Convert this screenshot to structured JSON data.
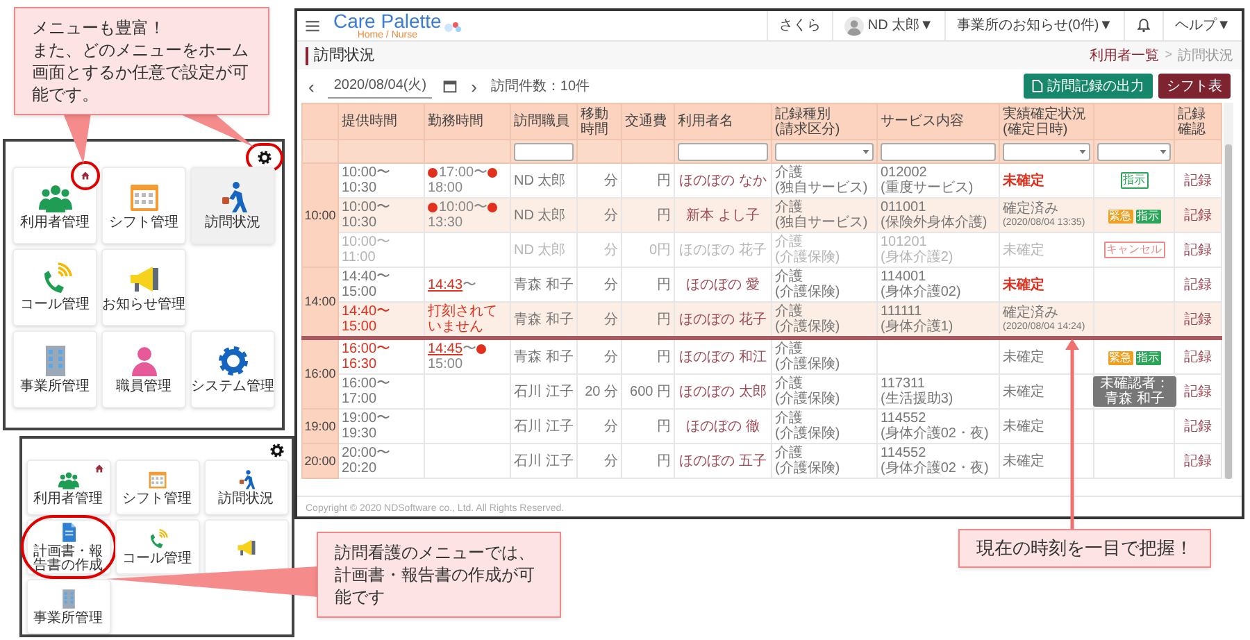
{
  "menu_callout": {
    "lines": [
      "メニューも豊富！",
      "また、どのメニューをホーム画面とするか任意で設定が可能です。"
    ]
  },
  "menu_panel": {
    "gear_circled": true,
    "rows": [
      [
        {
          "kind": "users",
          "label": "利用者管理",
          "selected": false,
          "home": true,
          "circled": true
        },
        {
          "kind": "calendar",
          "label": "シフト管理",
          "selected": false
        },
        {
          "kind": "walker",
          "label": "訪問状況",
          "selected": true
        }
      ],
      [
        {
          "kind": "phone",
          "label": "コール管理",
          "selected": false
        },
        {
          "kind": "megaphone",
          "label": "お知らせ管理",
          "selected": false
        }
      ],
      [
        {
          "kind": "building",
          "label": "事業所管理",
          "selected": false
        },
        {
          "kind": "staff",
          "label": "職員管理",
          "selected": false
        },
        {
          "kind": "gear",
          "label": "システム管理",
          "selected": false
        }
      ]
    ]
  },
  "nurse_panel": {
    "rows": [
      [
        {
          "kind": "users",
          "label": "利用者管理",
          "selected": false,
          "home": true
        },
        {
          "kind": "calendar",
          "label": "シフト管理",
          "selected": false
        },
        {
          "kind": "walker",
          "label": "訪問状況",
          "selected": false
        }
      ],
      [
        {
          "kind": "document",
          "label": "計画書・報告書の作成",
          "selected": false,
          "circled": true
        },
        {
          "kind": "phone",
          "label": "コール管理",
          "selected": false
        },
        {
          "kind": "megaphone",
          "selected": false
        }
      ],
      [
        {
          "kind": "building",
          "label": "事業所管理",
          "selected": false
        }
      ]
    ]
  },
  "nurse_callout": {
    "text": "訪問看護のメニューでは、計画書・報告書の作成が可能です"
  },
  "app": {
    "logo": {
      "name": "Care Palette",
      "sub": "Home / Nurse"
    },
    "office": "さくら",
    "user": "ND 太郎▼",
    "notices": "事業所のお知らせ(0件)▼",
    "help": "ヘルプ▼",
    "page_title": "訪問状況",
    "breadcrumbs": [
      {
        "label": "利用者一覧",
        "kind": "link"
      },
      {
        "label": ">",
        "kind": "separator"
      },
      {
        "label": "訪問状況",
        "kind": "current"
      }
    ],
    "date_nav": {
      "prev": "‹",
      "date": "2020/08/04(火)",
      "next": "›",
      "count": "訪問件数：10件"
    },
    "buttons": [
      {
        "label": "訪問記録の出力",
        "kind": "export"
      },
      {
        "label": "シフト表",
        "kind": "shift"
      }
    ],
    "table": {
      "columns": [
        {},
        {
          "label": "提供時間"
        },
        {
          "label": "勤務時間"
        },
        {
          "label": "訪問職員",
          "kind": "text_filter"
        },
        {
          "label": "移動時間"
        },
        {
          "label": "交通費"
        },
        {
          "label": "利用者名",
          "kind": "text_filter"
        },
        {
          "label": "記録種別\n(請求区分)",
          "kind": "select_filter"
        },
        {
          "label": "サービス内容",
          "kind": "text_filter"
        },
        {
          "label": "実績確定状況\n(確定日時)",
          "kind": "select_filter"
        },
        {
          "kind": "select_filter"
        },
        {
          "label": "記録確認"
        }
      ],
      "groups": [
        {
          "time": "10:00",
          "rows": [
            {
              "service_time": "10:00〜10:30",
              "time_alert": false,
              "work": [
                {
                  "text": "17:00",
                  "kind": "stamp"
                },
                {
                  "text": "〜",
                  "kind": "plain"
                },
                {
                  "text": "18:00",
                  "kind": "stamp"
                }
              ],
              "staff": "ND 太郎",
              "travel": "分",
              "fare": "円",
              "client": "ほのぼの なか",
              "record_type": "介護",
              "claim": "(独自サービス)",
              "service_code": "012002",
              "service_name": "(重度サービス)",
              "status": {
                "text": "未確定",
                "alert": true
              },
              "badges": [
                {
                  "label": "指示",
                  "kind": "instruction_outline"
                }
              ],
              "record": "記録",
              "highlight": false,
              "cancelled": false,
              "now_line": false
            },
            {
              "service_time": "10:00〜10:30",
              "time_alert": false,
              "work": [
                {
                  "text": "10:00",
                  "kind": "stamp"
                },
                {
                  "text": "〜",
                  "kind": "plain"
                },
                {
                  "text": "13:30",
                  "kind": "stamp"
                }
              ],
              "staff": "ND 太郎",
              "travel": "分",
              "fare": "円",
              "client": "新本 よし子",
              "record_type": "介護",
              "claim": "(独自サービス)",
              "service_code": "011001",
              "service_name": "(保険外身体介護)",
              "status": {
                "text": "確定済み",
                "alert": false,
                "date": "(2020/08/04 13:35)"
              },
              "badges": [
                {
                  "label": "緊急",
                  "kind": "urgent"
                },
                {
                  "label": "指示",
                  "kind": "instruction"
                }
              ],
              "record": "記録",
              "highlight": true,
              "cancelled": false,
              "now_line": false
            },
            {
              "service_time": "10:00〜11:00",
              "time_alert": false,
              "staff": "ND 太郎",
              "travel": "分",
              "fare": "0円",
              "client": "ほのぼの 花子",
              "record_type": "介護",
              "claim": "(介護保険)",
              "service_code": "101201",
              "service_name": "(身体介護2)",
              "status": {
                "text": "未確定",
                "alert": false
              },
              "badges": [
                {
                  "label": "キャンセル",
                  "kind": "cancel"
                }
              ],
              "record": "記録",
              "highlight": false,
              "cancelled": true,
              "now_line": false
            }
          ]
        },
        {
          "time": "14:00",
          "rows": [
            {
              "service_time": "14:40〜15:00",
              "time_alert": false,
              "work": [
                {
                  "text": "14:43",
                  "kind": "late"
                },
                {
                  "text": "〜",
                  "kind": "plain"
                }
              ],
              "staff": "青森 和子",
              "travel": "分",
              "fare": "円",
              "client": "ほのぼの 愛",
              "record_type": "介護",
              "claim": "(介護保険)",
              "service_code": "114001",
              "service_name": "(身体介護02)",
              "status": {
                "text": "未確定",
                "alert": true
              },
              "record": "記録",
              "highlight": false,
              "cancelled": false,
              "now_line": false
            },
            {
              "service_time": "14:40〜15:00",
              "time_alert": true,
              "work": [
                {
                  "text": "打刻されていません",
                  "kind": "missing"
                }
              ],
              "staff": "青森 和子",
              "travel": "分",
              "fare": "円",
              "client": "ほのぼの 花子",
              "record_type": "介護",
              "claim": "(介護保険)",
              "service_code": "111111",
              "service_name": "(身体介護1)",
              "status": {
                "text": "確定済み",
                "alert": false,
                "date": "(2020/08/04 14:24)"
              },
              "record": "記録",
              "highlight": true,
              "cancelled": false,
              "now_line": true
            }
          ]
        },
        {
          "time": "16:00",
          "rows": [
            {
              "service_time": "16:00〜16:30",
              "time_alert": true,
              "work": [
                {
                  "text": "14:45",
                  "kind": "late"
                },
                {
                  "text": "〜",
                  "kind": "plain"
                },
                {
                  "text": "15:00",
                  "kind": "stamp"
                }
              ],
              "staff": "青森 和子",
              "travel": "分",
              "fare": "円",
              "client": "ほのぼの 和江",
              "record_type": "介護",
              "claim": "(介護保険)",
              "status": {
                "text": "未確定",
                "alert": false
              },
              "badges": [
                {
                  "label": "緊急",
                  "kind": "urgent"
                },
                {
                  "label": "指示",
                  "kind": "instruction"
                }
              ],
              "record": "記録",
              "highlight": false,
              "cancelled": false,
              "now_line": false
            },
            {
              "service_time": "16:00〜17:00",
              "time_alert": false,
              "staff": "石川 江子",
              "travel": "20 分",
              "fare": "600 円",
              "client": "ほのぼの 太郎",
              "record_type": "介護",
              "claim": "(介護保険)",
              "service_code": "117311",
              "service_name": "(生活援助3)",
              "status": {
                "text": "未確定",
                "alert": false
              },
              "tooltip": "未確認者：青森 和子",
              "record": "記録",
              "highlight": false,
              "cancelled": false,
              "now_line": false
            }
          ]
        },
        {
          "time": "19:00",
          "rows": [
            {
              "service_time": "19:00〜19:30",
              "time_alert": false,
              "staff": "石川 江子",
              "travel": "分",
              "fare": "円",
              "client": "ほのぼの 徹",
              "record_type": "介護",
              "claim": "(介護保険)",
              "service_code": "114552",
              "service_name": "(身体介護02・夜)",
              "status": {
                "text": "未確定",
                "alert": false
              },
              "record": "記録",
              "highlight": false,
              "cancelled": false,
              "now_line": false
            }
          ]
        },
        {
          "time": "20:00",
          "rows": [
            {
              "service_time": "20:00〜20:20",
              "time_alert": false,
              "staff": "石川 江子",
              "travel": "分",
              "fare": "円",
              "client": "ほのぼの 五子",
              "record_type": "介護",
              "claim": "(介護保険)",
              "service_code": "114552",
              "service_name": "(身体介護02・夜)",
              "status": {
                "text": "未確定",
                "alert": false
              },
              "record": "記録",
              "highlight": false,
              "cancelled": false,
              "now_line": false
            }
          ]
        }
      ]
    },
    "footer": "Copyright © 2020 NDSoftware co., Ltd. All Rights Reserved."
  },
  "time_callout": {
    "text": "現在の時刻を一目で把握！"
  }
}
